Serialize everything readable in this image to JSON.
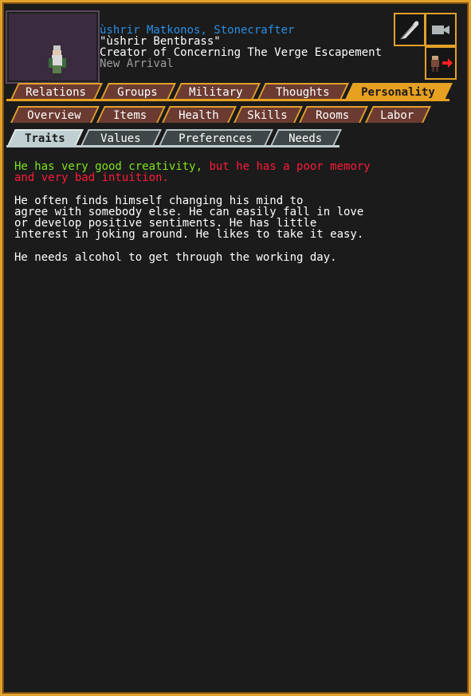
{
  "unit": {
    "name": "ùshrir Matkonos, Stonecrafter",
    "nickname": "\"ùshrir Bentbrass\"",
    "title": "Creator of Concerning The Verge Escapement",
    "status": "New Arrival"
  },
  "icons": [
    "portrait-dwarf-icon",
    "feather-quill-icon",
    "camera-icon",
    "dwarf-exit-icon"
  ],
  "tabs_main": [
    "Relations",
    "Groups",
    "Military",
    "Thoughts",
    "Personality"
  ],
  "tabs_sub": [
    "Overview",
    "Items",
    "Health",
    "Skills",
    "Rooms",
    "Labor"
  ],
  "tabs_personality": [
    "Traits",
    "Values",
    "Preferences",
    "Needs"
  ],
  "active": {
    "main": "Personality",
    "personality": "Traits"
  },
  "traits": {
    "good": "He has very good creativity,",
    "bad_line1": " but he has a poor memory",
    "bad_line2": "and very bad intuition.",
    "para1": [
      "He often finds himself changing his mind to",
      "agree with somebody else. He can easily fall in love",
      "or develop positive sentiments. He has little",
      "interest in joking around. He likes to take it easy."
    ],
    "para2": "He needs alcohol to get through the working day."
  },
  "colors": {
    "frame": "#e2a12a",
    "name": "#2a8fe6",
    "positive": "#7ee31d",
    "negative": "#ff1a3a"
  }
}
